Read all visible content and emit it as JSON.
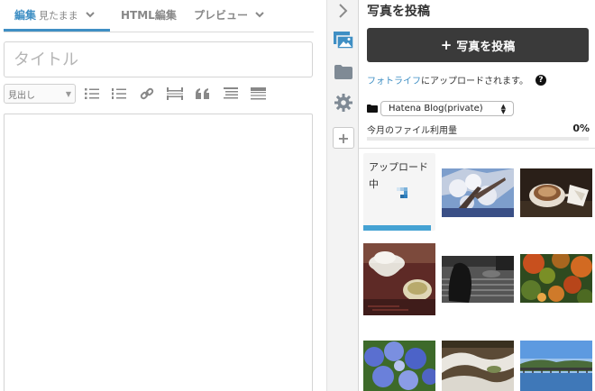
{
  "editor": {
    "tabs": [
      {
        "label": "編集",
        "sub": "見たまま",
        "active": true
      },
      {
        "label": "HTML編集",
        "sub": "",
        "active": false
      },
      {
        "label": "プレビュー",
        "sub": "",
        "active": false
      }
    ],
    "title_placeholder": "タイトル",
    "heading_select": "見出し"
  },
  "icons": {
    "format": [
      "bullet-list-icon",
      "numbered-list-icon",
      "link-icon",
      "read-more-icon",
      "quote-icon",
      "table-of-contents-icon",
      "table-icon"
    ],
    "column": [
      "collapse-chevron-icon",
      "photo-icon",
      "folder-icon",
      "gear-icon",
      "plus-icon"
    ]
  },
  "panel": {
    "title": "写真を投稿",
    "post_button": "写真を投稿",
    "upload_link": "フォトライフ",
    "upload_text": "にアップロードされます。",
    "help": "?",
    "blog_select": "Hatena Blog(private)",
    "usage_label": "今月のファイル利用量",
    "usage_pct": "0%",
    "usage_fraction": 0.0,
    "uploading_label": "アップロード中",
    "upload_progress": 1.0
  },
  "colors": {
    "accent": "#3f8fc4",
    "button_bg": "#3a3a3a",
    "progress": "#45a2d3"
  }
}
